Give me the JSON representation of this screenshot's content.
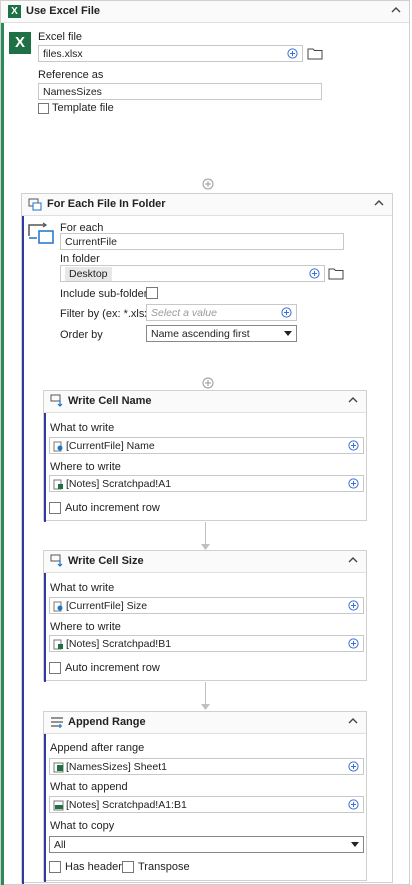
{
  "use_excel": {
    "title": "Use Excel File",
    "excel_file_label": "Excel file",
    "excel_file_value": "files.xlsx",
    "reference_label": "Reference as",
    "reference_value": "NamesSizes",
    "template_label": "Template file"
  },
  "for_each": {
    "title": "For Each File In Folder",
    "for_each_label": "For each",
    "for_each_value": "CurrentFile",
    "in_folder_label": "In folder",
    "in_folder_value": "Desktop",
    "include_sub_label": "Include sub-folders",
    "filter_label": "Filter by (ex: *.xlsx)",
    "filter_placeholder": "Select a value",
    "order_label": "Order by",
    "order_value": "Name ascending first"
  },
  "write_name": {
    "title": "Write Cell Name",
    "what_label": "What to write",
    "what_value": "[CurrentFile] Name",
    "where_label": "Where to write",
    "where_value": "[Notes] Scratchpad!A1",
    "auto_label": "Auto increment row"
  },
  "write_size": {
    "title": "Write Cell Size",
    "what_label": "What to write",
    "what_value": "[CurrentFile] Size",
    "where_label": "Where to write",
    "where_value": "[Notes] Scratchpad!B1",
    "auto_label": "Auto increment row"
  },
  "append": {
    "title": "Append Range",
    "after_label": "Append after range",
    "after_value": "[NamesSizes] Sheet1",
    "what_label": "What to append",
    "what_value": "[Notes] Scratchpad!A1:B1",
    "copy_label": "What to copy",
    "copy_value": "All",
    "headers_label": "Has headers",
    "transpose_label": "Transpose"
  },
  "colors": {
    "excel_green": "#1e7145",
    "accent_green": "#2b8a5a",
    "accent_blue": "#2f3c9e",
    "icon_blue": "#1e73c8"
  }
}
